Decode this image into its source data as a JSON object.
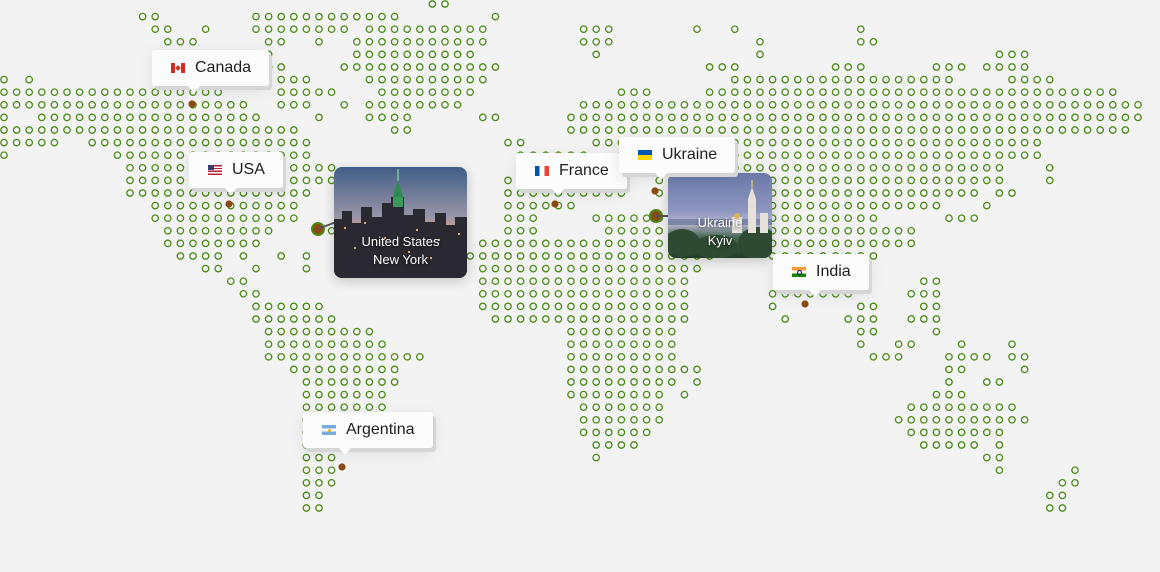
{
  "map": {
    "dot_color": "#4c8a18",
    "pin_color": "#8a4a12",
    "background": "#f3f3f3",
    "markers": [
      {
        "name": "Canada",
        "flag": "canada-flag-icon"
      },
      {
        "name": "USA",
        "flag": "usa-flag-icon"
      },
      {
        "name": "France",
        "flag": "france-flag-icon"
      },
      {
        "name": "Ukraine",
        "flag": "ukraine-flag-icon"
      },
      {
        "name": "India",
        "flag": "india-flag-icon"
      },
      {
        "name": "Argentina",
        "flag": "argentina-flag-icon"
      }
    ],
    "photo_cards": [
      {
        "country": "United States",
        "city": "New York"
      },
      {
        "country": "Ukraine",
        "city": "Kyiv"
      }
    ]
  }
}
